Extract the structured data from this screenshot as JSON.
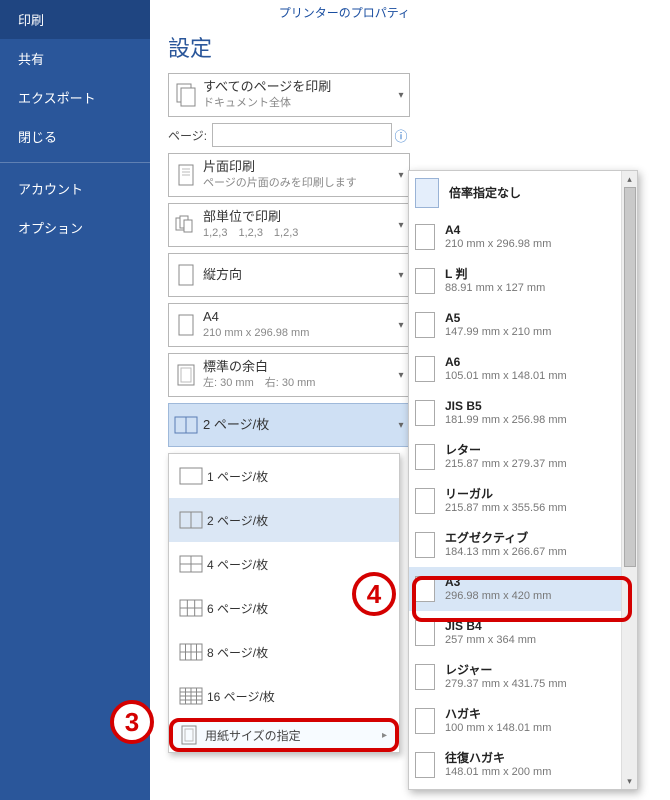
{
  "sidebar": {
    "items": [
      {
        "label": "印刷",
        "selected": true
      },
      {
        "label": "共有"
      },
      {
        "label": "エクスポート"
      },
      {
        "label": "閉じる"
      },
      {
        "label": "アカウント"
      },
      {
        "label": "オプション"
      }
    ]
  },
  "printer_properties_link": "プリンターのプロパティ",
  "heading": "設定",
  "combos": {
    "scope": {
      "title": "すべてのページを印刷",
      "sub": "ドキュメント全体"
    },
    "sides": {
      "title": "片面印刷",
      "sub": "ページの片面のみを印刷します"
    },
    "collate": {
      "title": "部単位で印刷",
      "sub": "1,2,3　1,2,3　1,2,3"
    },
    "orient": {
      "title": "縦方向",
      "sub": ""
    },
    "paper": {
      "title": "A4",
      "sub": "210 mm x 296.98 mm"
    },
    "margins": {
      "title": "標準の余白",
      "sub": "左: 30 mm　右: 30 mm"
    },
    "pps": {
      "title": "2 ページ/枚",
      "sub": ""
    }
  },
  "pages_label": "ページ:",
  "pages_value": "",
  "pps_menu": {
    "items": [
      {
        "label": "1 ページ/枚"
      },
      {
        "label": "2 ページ/枚",
        "selected": true
      },
      {
        "label": "4 ページ/枚"
      },
      {
        "label": "6 ページ/枚"
      },
      {
        "label": "8 ページ/枚"
      },
      {
        "label": "16 ページ/枚"
      }
    ],
    "footer": "用紙サイズの指定"
  },
  "paper_sizes": [
    {
      "name": "倍率指定なし",
      "dims": ""
    },
    {
      "name": "A4",
      "dims": "210 mm x 296.98 mm"
    },
    {
      "name": "L 判",
      "dims": "88.91 mm x 127 mm"
    },
    {
      "name": "A5",
      "dims": "147.99 mm x 210 mm"
    },
    {
      "name": "A6",
      "dims": "105.01 mm x 148.01 mm"
    },
    {
      "name": "JIS B5",
      "dims": "181.99 mm x 256.98 mm"
    },
    {
      "name": "レター",
      "dims": "215.87 mm x 279.37 mm"
    },
    {
      "name": "リーガル",
      "dims": "215.87 mm x 355.56 mm"
    },
    {
      "name": "エグゼクティブ",
      "dims": "184.13 mm x 266.67 mm"
    },
    {
      "name": "A3",
      "dims": "296.98 mm x 420 mm",
      "selected": true
    },
    {
      "name": "JIS B4",
      "dims": "257 mm x 364 mm"
    },
    {
      "name": "レジャー",
      "dims": "279.37 mm x 431.75 mm"
    },
    {
      "name": "ハガキ",
      "dims": "100 mm x 148.01 mm"
    },
    {
      "name": "往復ハガキ",
      "dims": "148.01 mm x 200 mm"
    }
  ],
  "callouts": {
    "c3": "3",
    "c4": "4"
  }
}
